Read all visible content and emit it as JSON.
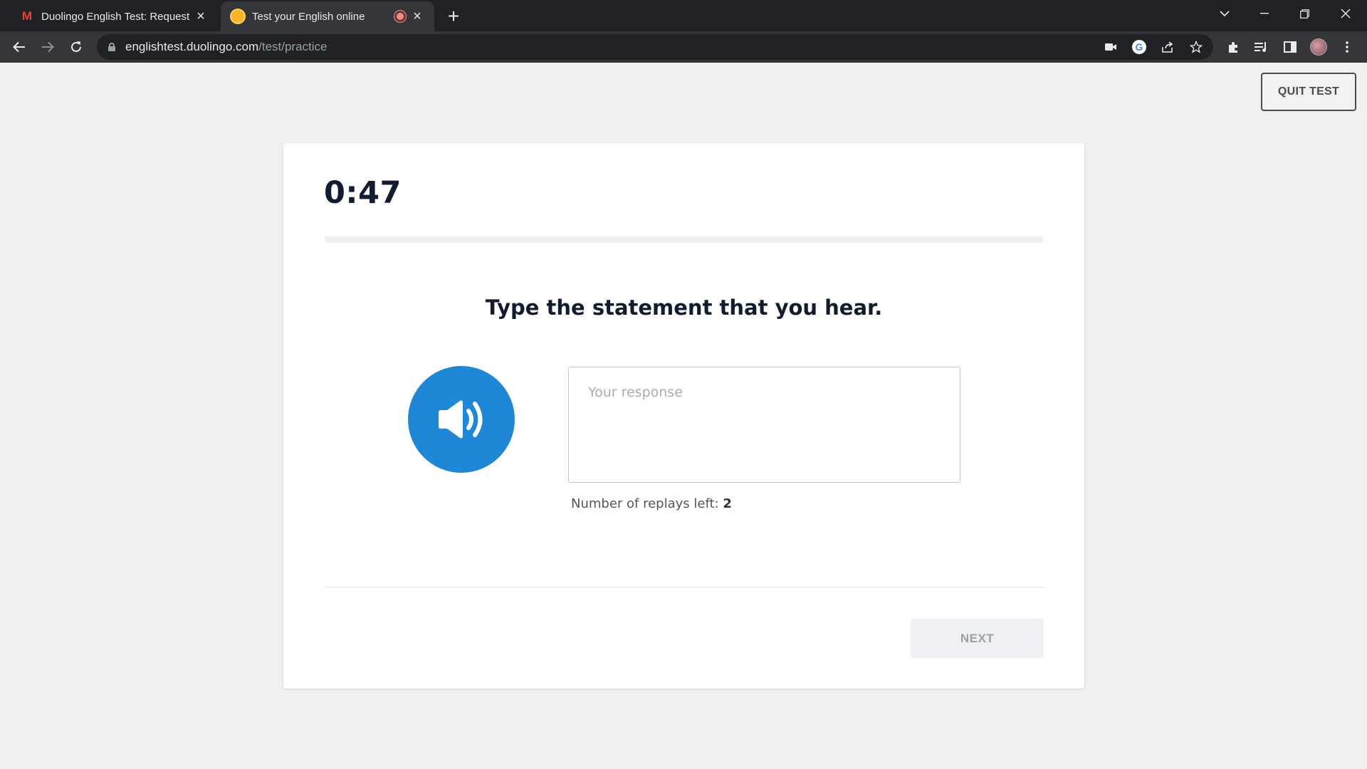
{
  "browser": {
    "tabs": [
      {
        "title": "Duolingo English Test: Request O",
        "favicon": "gmail-icon",
        "active": false
      },
      {
        "title": "Test your English online",
        "favicon": "duolingo-sun-icon",
        "active": true,
        "recording": true
      }
    ],
    "url": {
      "host": "englishtest.duolingo.com",
      "path": "/test/practice"
    },
    "toolbar_icons": [
      "camera-icon",
      "google-icon",
      "share-icon",
      "star-icon",
      "extensions-icon",
      "media-control-icon",
      "side-panel-icon",
      "profile-avatar",
      "menu-icon"
    ]
  },
  "page": {
    "quit_label": "QUIT TEST",
    "timer": "0:47",
    "progress_fraction": 0.0,
    "prompt": "Type the statement that you hear.",
    "response_placeholder": "Your response",
    "replays_label": "Number of replays left:",
    "replays_count": "2",
    "next_label": "NEXT"
  },
  "colors": {
    "speaker_button": "#1e87d6",
    "text_dark": "#111c2f",
    "page_bg": "#f0f0f0"
  }
}
